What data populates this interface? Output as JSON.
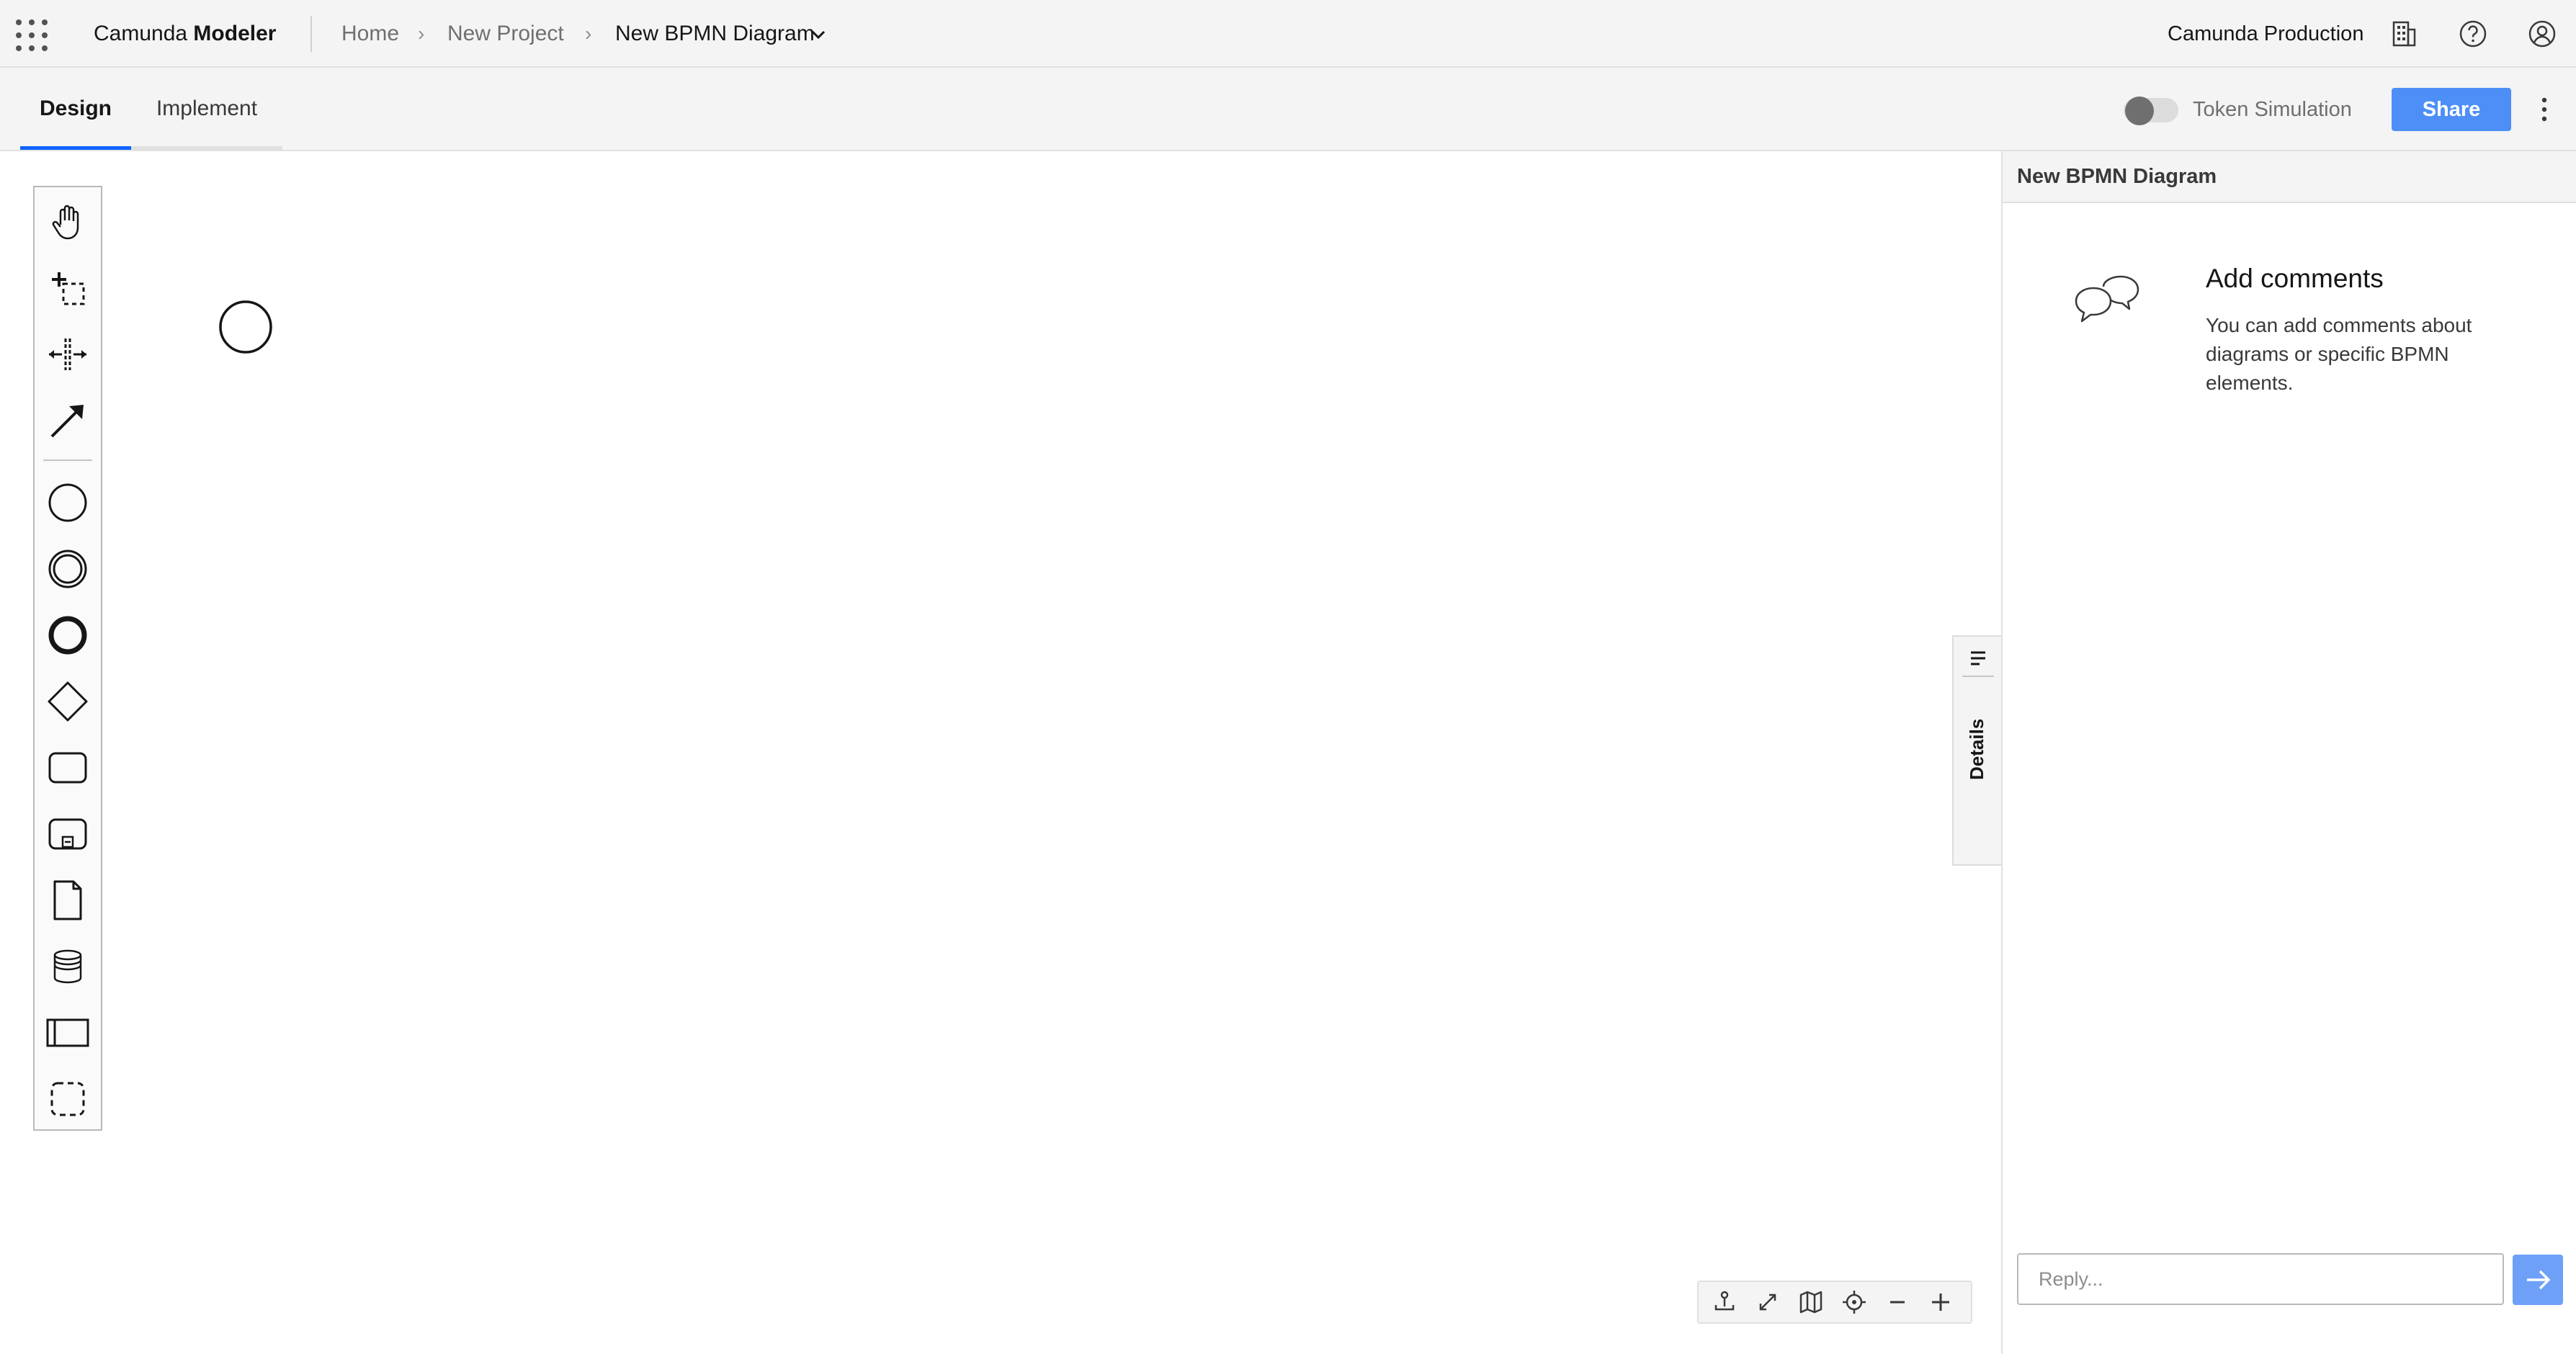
{
  "header": {
    "brand_prefix": "Camunda",
    "brand_bold": "Modeler",
    "breadcrumbs": [
      "Home",
      "New Project",
      "New BPMN Diagram"
    ],
    "separator": "›",
    "org_name": "Camunda Production",
    "icons": [
      "app-switcher-icon",
      "organization-icon",
      "help-icon",
      "user-icon"
    ]
  },
  "tabs": [
    {
      "label": "Design",
      "active": true
    },
    {
      "label": "Implement",
      "active": false
    }
  ],
  "toolbar": {
    "token_simulation_label": "Token Simulation",
    "token_simulation_on": false,
    "share_label": "Share"
  },
  "palette": {
    "tools": [
      "hand-tool",
      "lasso-tool",
      "space-tool",
      "global-connect-tool"
    ],
    "elements": [
      "start-event",
      "intermediate-event",
      "end-event",
      "gateway",
      "task",
      "subprocess",
      "data-object",
      "data-store",
      "pool",
      "group"
    ]
  },
  "details_tab": {
    "label": "Details"
  },
  "panel": {
    "title": "New BPMN Diagram",
    "comments_heading": "Add comments",
    "comments_text": "You can add comments about diagrams or specific BPMN elements.",
    "reply_placeholder": "Reply..."
  },
  "zoom_controls": [
    "download-icon",
    "fullscreen-icon",
    "minimap-icon",
    "reset-view-icon",
    "zoom-out-icon",
    "zoom-in-icon"
  ],
  "colors": {
    "accent": "#0f62fe",
    "share": "#4d8ff7",
    "send": "#6ea0f8"
  }
}
